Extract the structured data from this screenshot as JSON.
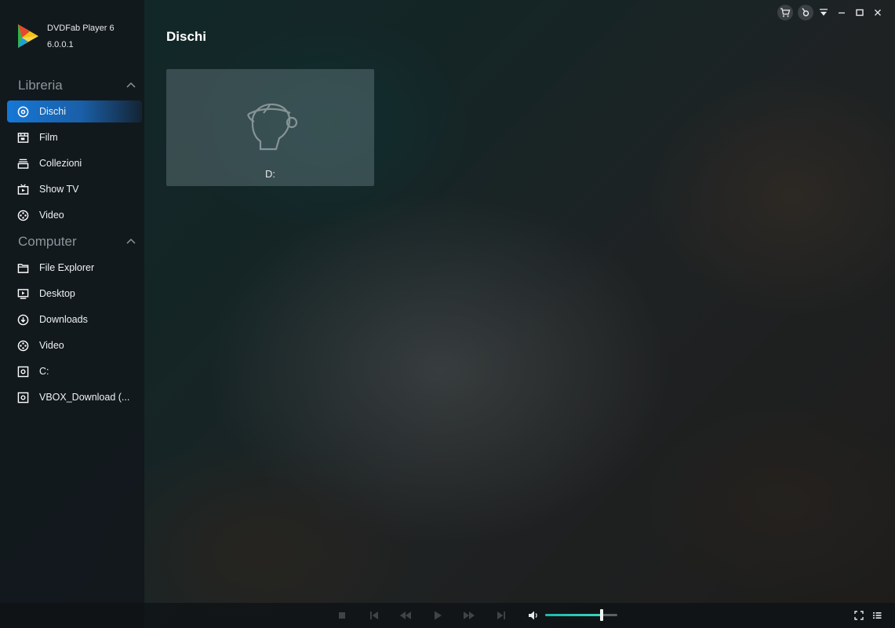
{
  "app": {
    "name": "DVDFab Player 6",
    "version": "6.0.0.1"
  },
  "colors": {
    "accent": "#1677d6",
    "volume": "#2cc7b4",
    "sidebar_bg": "#12181c"
  },
  "sidebar": {
    "sections": [
      {
        "title": "Libreria",
        "items": [
          {
            "label": "Dischi",
            "icon": "disc-icon",
            "active": true
          },
          {
            "label": "Film",
            "icon": "film-icon"
          },
          {
            "label": "Collezioni",
            "icon": "collection-icon"
          },
          {
            "label": "Show TV",
            "icon": "tv-icon"
          },
          {
            "label": "Video",
            "icon": "video-reel-icon"
          }
        ]
      },
      {
        "title": "Computer",
        "items": [
          {
            "label": "File Explorer",
            "icon": "folder-icon"
          },
          {
            "label": "Desktop",
            "icon": "desktop-icon"
          },
          {
            "label": "Downloads",
            "icon": "download-icon"
          },
          {
            "label": "Video",
            "icon": "video-reel-icon"
          },
          {
            "label": "C:",
            "icon": "drive-icon"
          },
          {
            "label": "VBOX_Download (...",
            "icon": "drive-icon"
          }
        ]
      }
    ]
  },
  "main": {
    "title": "Dischi",
    "discs": [
      {
        "label": "D:"
      }
    ]
  },
  "titlebar": {
    "icons": [
      "cart-icon",
      "settings-icon",
      "menu-icon",
      "minimize-icon",
      "maximize-icon",
      "close-icon"
    ]
  },
  "player": {
    "buttons": [
      "stop-icon",
      "previous-icon",
      "rewind-icon",
      "play-icon",
      "fast-forward-icon",
      "next-icon"
    ],
    "volume": 0.78,
    "right_icons": [
      "fullscreen-icon",
      "playlist-icon"
    ]
  }
}
